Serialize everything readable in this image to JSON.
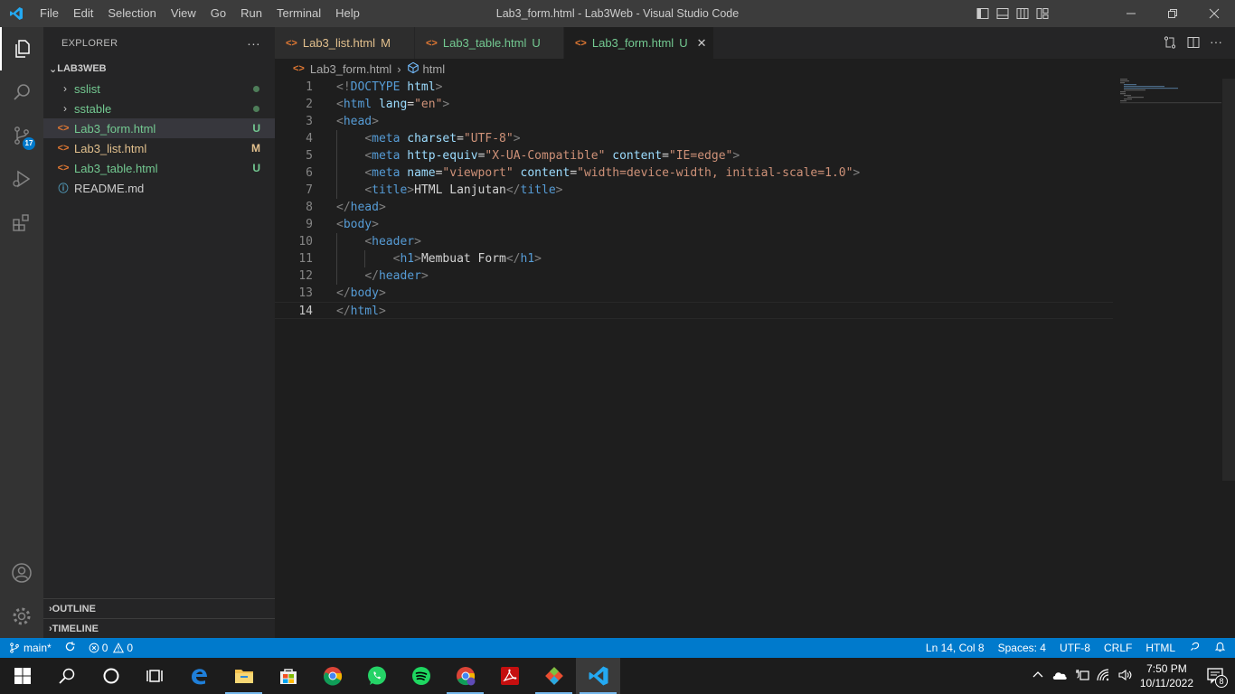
{
  "window": {
    "title": "Lab3_form.html - Lab3Web - Visual Studio Code"
  },
  "menu": [
    "File",
    "Edit",
    "Selection",
    "View",
    "Go",
    "Run",
    "Terminal",
    "Help"
  ],
  "activity": {
    "scm_badge": "17"
  },
  "sidebar": {
    "header": "EXPLORER",
    "more": "···",
    "root": "LAB3WEB",
    "items": [
      {
        "label": "sslist",
        "type": "folder",
        "status": "",
        "color": "#73c991"
      },
      {
        "label": "sstable",
        "type": "folder",
        "status": "",
        "color": "#73c991"
      },
      {
        "label": "Lab3_form.html",
        "type": "html",
        "status": "U",
        "color": "#73c991"
      },
      {
        "label": "Lab3_list.html",
        "type": "html",
        "status": "M",
        "color": "#e2c08d"
      },
      {
        "label": "Lab3_table.html",
        "type": "html",
        "status": "U",
        "color": "#73c991"
      },
      {
        "label": "README.md",
        "type": "info",
        "status": "",
        "color": "#cccccc"
      }
    ],
    "outline": "OUTLINE",
    "timeline": "TIMELINE"
  },
  "tabs": [
    {
      "label": "Lab3_list.html",
      "status": "M",
      "color": "#e2c08d"
    },
    {
      "label": "Lab3_table.html",
      "status": "U",
      "color": "#73c991"
    },
    {
      "label": "Lab3_form.html",
      "status": "U",
      "color": "#73c991"
    }
  ],
  "breadcrumb": {
    "file": "Lab3_form.html",
    "symbol": "html"
  },
  "editor": {
    "lines": [
      "<!DOCTYPE html>",
      "<html lang=\"en\">",
      "<head>",
      "    <meta charset=\"UTF-8\">",
      "    <meta http-equiv=\"X-UA-Compatible\" content=\"IE=edge\">",
      "    <meta name=\"viewport\" content=\"width=device-width, initial-scale=1.0\">",
      "    <title>HTML Lanjutan</title>",
      "</head>",
      "<body>",
      "    <header>",
      "        <h1>Membuat Form</h1>",
      "    </header>",
      "</body>",
      "</html>"
    ],
    "current_line": 14
  },
  "statusbar": {
    "branch": "main*",
    "errors": "0",
    "warnings": "0",
    "position": "Ln 14, Col 8",
    "spaces": "Spaces: 4",
    "encoding": "UTF-8",
    "eol": "CRLF",
    "language": "HTML"
  },
  "taskbar": {
    "time": "7:50 PM",
    "date": "10/11/2022",
    "notifications": "8"
  }
}
